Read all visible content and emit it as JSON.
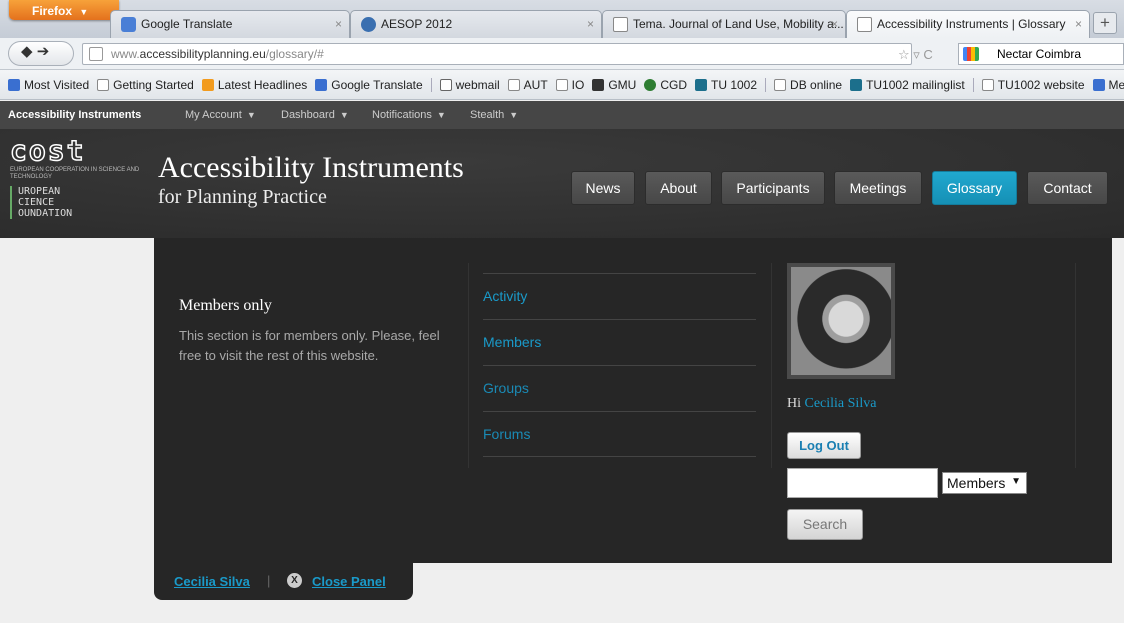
{
  "browser": {
    "menu_label": "Firefox",
    "menu_caret": "▼",
    "tabs": [
      {
        "title": "Google Translate"
      },
      {
        "title": "AESOP 2012"
      },
      {
        "title": "Tema. Journal of Land Use, Mobility a..."
      },
      {
        "title": "Accessibility Instruments | Glossary"
      }
    ],
    "tab_close": "×",
    "new_tab": "+",
    "back_forward": "◆ ➔",
    "url_prefix": "www.",
    "url_host": "accessibilityplanning.eu",
    "url_path": "/glossary/#",
    "url_actions": "☆ ▿ C",
    "search_engine_label": "Nectar Coimbra",
    "bookmarks": [
      {
        "label": "Most Visited",
        "icon": "blue"
      },
      {
        "label": "Getting Started",
        "icon": "blank"
      },
      {
        "label": "Latest Headlines",
        "icon": "orange"
      },
      {
        "label": "Google Translate",
        "icon": "blue"
      },
      {
        "label": "webmail",
        "icon": "mail"
      },
      {
        "label": "AUT",
        "icon": "blank"
      },
      {
        "label": "IO",
        "icon": "blank"
      },
      {
        "label": "GMU",
        "icon": "dark"
      },
      {
        "label": "CGD",
        "icon": "green"
      },
      {
        "label": "TU 1002",
        "icon": "teal"
      },
      {
        "label": "DB online",
        "icon": "blank"
      },
      {
        "label": "TU1002 mailinglist",
        "icon": "teal"
      },
      {
        "label": "TU1002 website",
        "icon": "blank"
      },
      {
        "label": "Meteo",
        "icon": "blue"
      }
    ]
  },
  "adminbar": {
    "brand": "Accessibility Instruments",
    "menus": [
      "My Account",
      "Dashboard",
      "Notifications",
      "Stealth"
    ],
    "caret": "▼"
  },
  "header": {
    "logo_text": "cost",
    "logo_sub": "EUROPEAN COOPERATION IN SCIENCE AND TECHNOLOGY",
    "esf_lines": [
      "UROPEAN",
      "CIENCE",
      "OUNDATION"
    ],
    "title": "Accessibility Instruments",
    "subtitle": "for Planning Practice",
    "nav": [
      {
        "label": "News"
      },
      {
        "label": "About"
      },
      {
        "label": "Participants"
      },
      {
        "label": "Meetings"
      },
      {
        "label": "Glossary",
        "active": true
      },
      {
        "label": "Contact"
      }
    ]
  },
  "panel": {
    "members_title": "Members only",
    "members_text": "This section is for members only. Please, feel free to visit the rest of this website.",
    "links": [
      "Activity",
      "Members",
      "Groups",
      "Forums"
    ],
    "greeting": "Hi",
    "user_name": "Cecilia Silva",
    "logout_label": "Log Out",
    "search_placeholder": "",
    "search_scope": "Members",
    "search_label": "Search",
    "tab_separator": "|",
    "close_symbol": "X",
    "close_label": "Close Panel"
  },
  "colors": {
    "accent": "#1a9ac9",
    "active_nav": "#1590b5",
    "panel_bg": "#262626",
    "header_bg": "#2f2f2f"
  }
}
